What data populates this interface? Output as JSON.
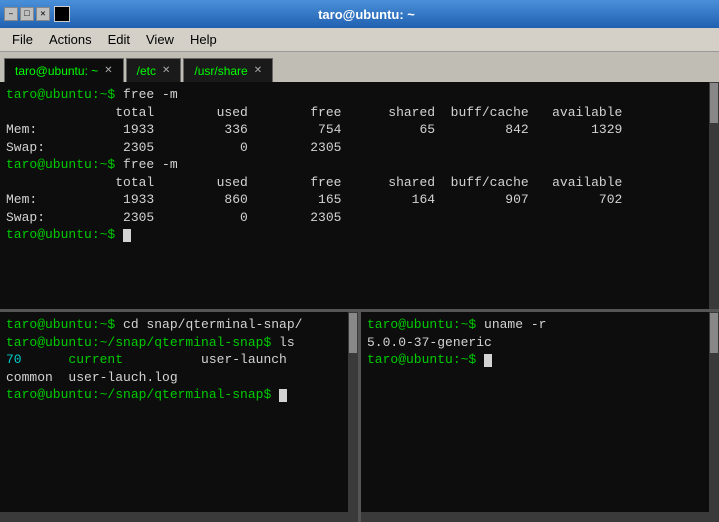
{
  "titleBar": {
    "title": "taro@ubuntu: ~",
    "minBtn": "–",
    "maxBtn": "□",
    "closeBtn": "✕"
  },
  "menuBar": {
    "items": [
      "File",
      "Actions",
      "Edit",
      "View",
      "Help"
    ]
  },
  "tabs": [
    {
      "label": "taro@ubuntu: ~",
      "active": true
    },
    {
      "label": "/etc",
      "active": false
    },
    {
      "label": "/usr/share",
      "active": false
    }
  ],
  "topPane": {
    "lines": [
      {
        "type": "prompt",
        "user": "taro@ubuntu:~$ ",
        "cmd": "free -m"
      },
      {
        "type": "header",
        "text": "              total        used        free      shared  buff/cache   available"
      },
      {
        "type": "data",
        "text": "Mem:           1933         336         754          65         842        1329"
      },
      {
        "type": "data",
        "text": "Swap:          2305           0        2305"
      },
      {
        "type": "prompt",
        "user": "taro@ubuntu:~$ ",
        "cmd": "free -m"
      },
      {
        "type": "header",
        "text": "              total        used        free      shared  buff/cache   available"
      },
      {
        "type": "data",
        "text": "Mem:           1933         860         165         164         907         702"
      },
      {
        "type": "data",
        "text": "Swap:          2305           0        2305"
      },
      {
        "type": "prompt-cursor",
        "user": "taro@ubuntu:~$ "
      }
    ]
  },
  "bottomLeftPane": {
    "lines": [
      {
        "type": "prompt",
        "user": "taro@ubuntu:~$ ",
        "cmd": "cd snap/qterminal-snap/"
      },
      {
        "type": "prompt",
        "user": "taro@ubuntu:~/snap/qterminal-snap$ ",
        "cmd": "ls"
      },
      {
        "type": "ls-row",
        "col1": "70",
        "col2": "current",
        "col3": "user-launch"
      },
      {
        "type": "ls-row2",
        "col1": "common",
        "col2": "user-lauch.log"
      },
      {
        "type": "prompt-cursor",
        "user": "taro@ubuntu:~/snap/qterminal-snap$ "
      }
    ]
  },
  "bottomRightPane": {
    "lines": [
      {
        "type": "prompt",
        "user": "taro@ubuntu:~$ ",
        "cmd": "uname -r"
      },
      {
        "type": "data",
        "text": "5.0.0-37-generic"
      },
      {
        "type": "prompt-cursor",
        "user": "taro@ubuntu:~$ "
      }
    ]
  }
}
